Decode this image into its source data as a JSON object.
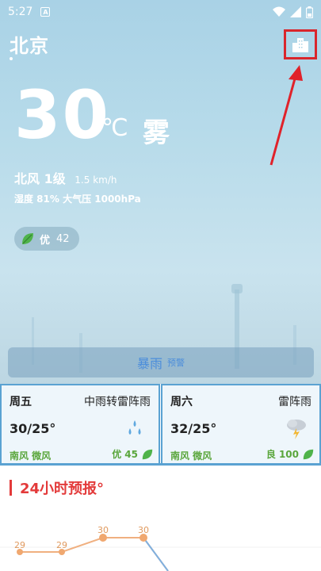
{
  "status_bar": {
    "time": "5:27",
    "app_icon": "A"
  },
  "header": {
    "city": "北京"
  },
  "current": {
    "temperature": "30",
    "unit": "℃",
    "condition": "雾",
    "wind": "北风 1级",
    "wind_speed": "1.5 km/h",
    "humidity_pressure": "湿度 81%  大气压 1000hPa",
    "aqi_label": "优",
    "aqi_value": "42"
  },
  "alert": {
    "label": "暴雨",
    "sub": "预警"
  },
  "forecast": [
    {
      "day": "周五",
      "condition": "中雨转雷阵雨",
      "temp": "30/25°",
      "wind": "南风  微风",
      "aqi_label": "优",
      "aqi_value": "45",
      "icon": "rain-icon"
    },
    {
      "day": "周六",
      "condition": "雷阵雨",
      "temp": "32/25°",
      "wind": "南风  微风",
      "aqi_label": "良",
      "aqi_value": "100",
      "icon": "thunderstorm-icon"
    }
  ],
  "hourly": {
    "title": "24小时预报°",
    "temps": [
      "29",
      "29",
      "30",
      "30"
    ]
  },
  "colors": {
    "accent_red": "#d9262c",
    "green": "#5aa63c",
    "blue_border": "#5aa2d2",
    "orange": "#e09a5f"
  }
}
